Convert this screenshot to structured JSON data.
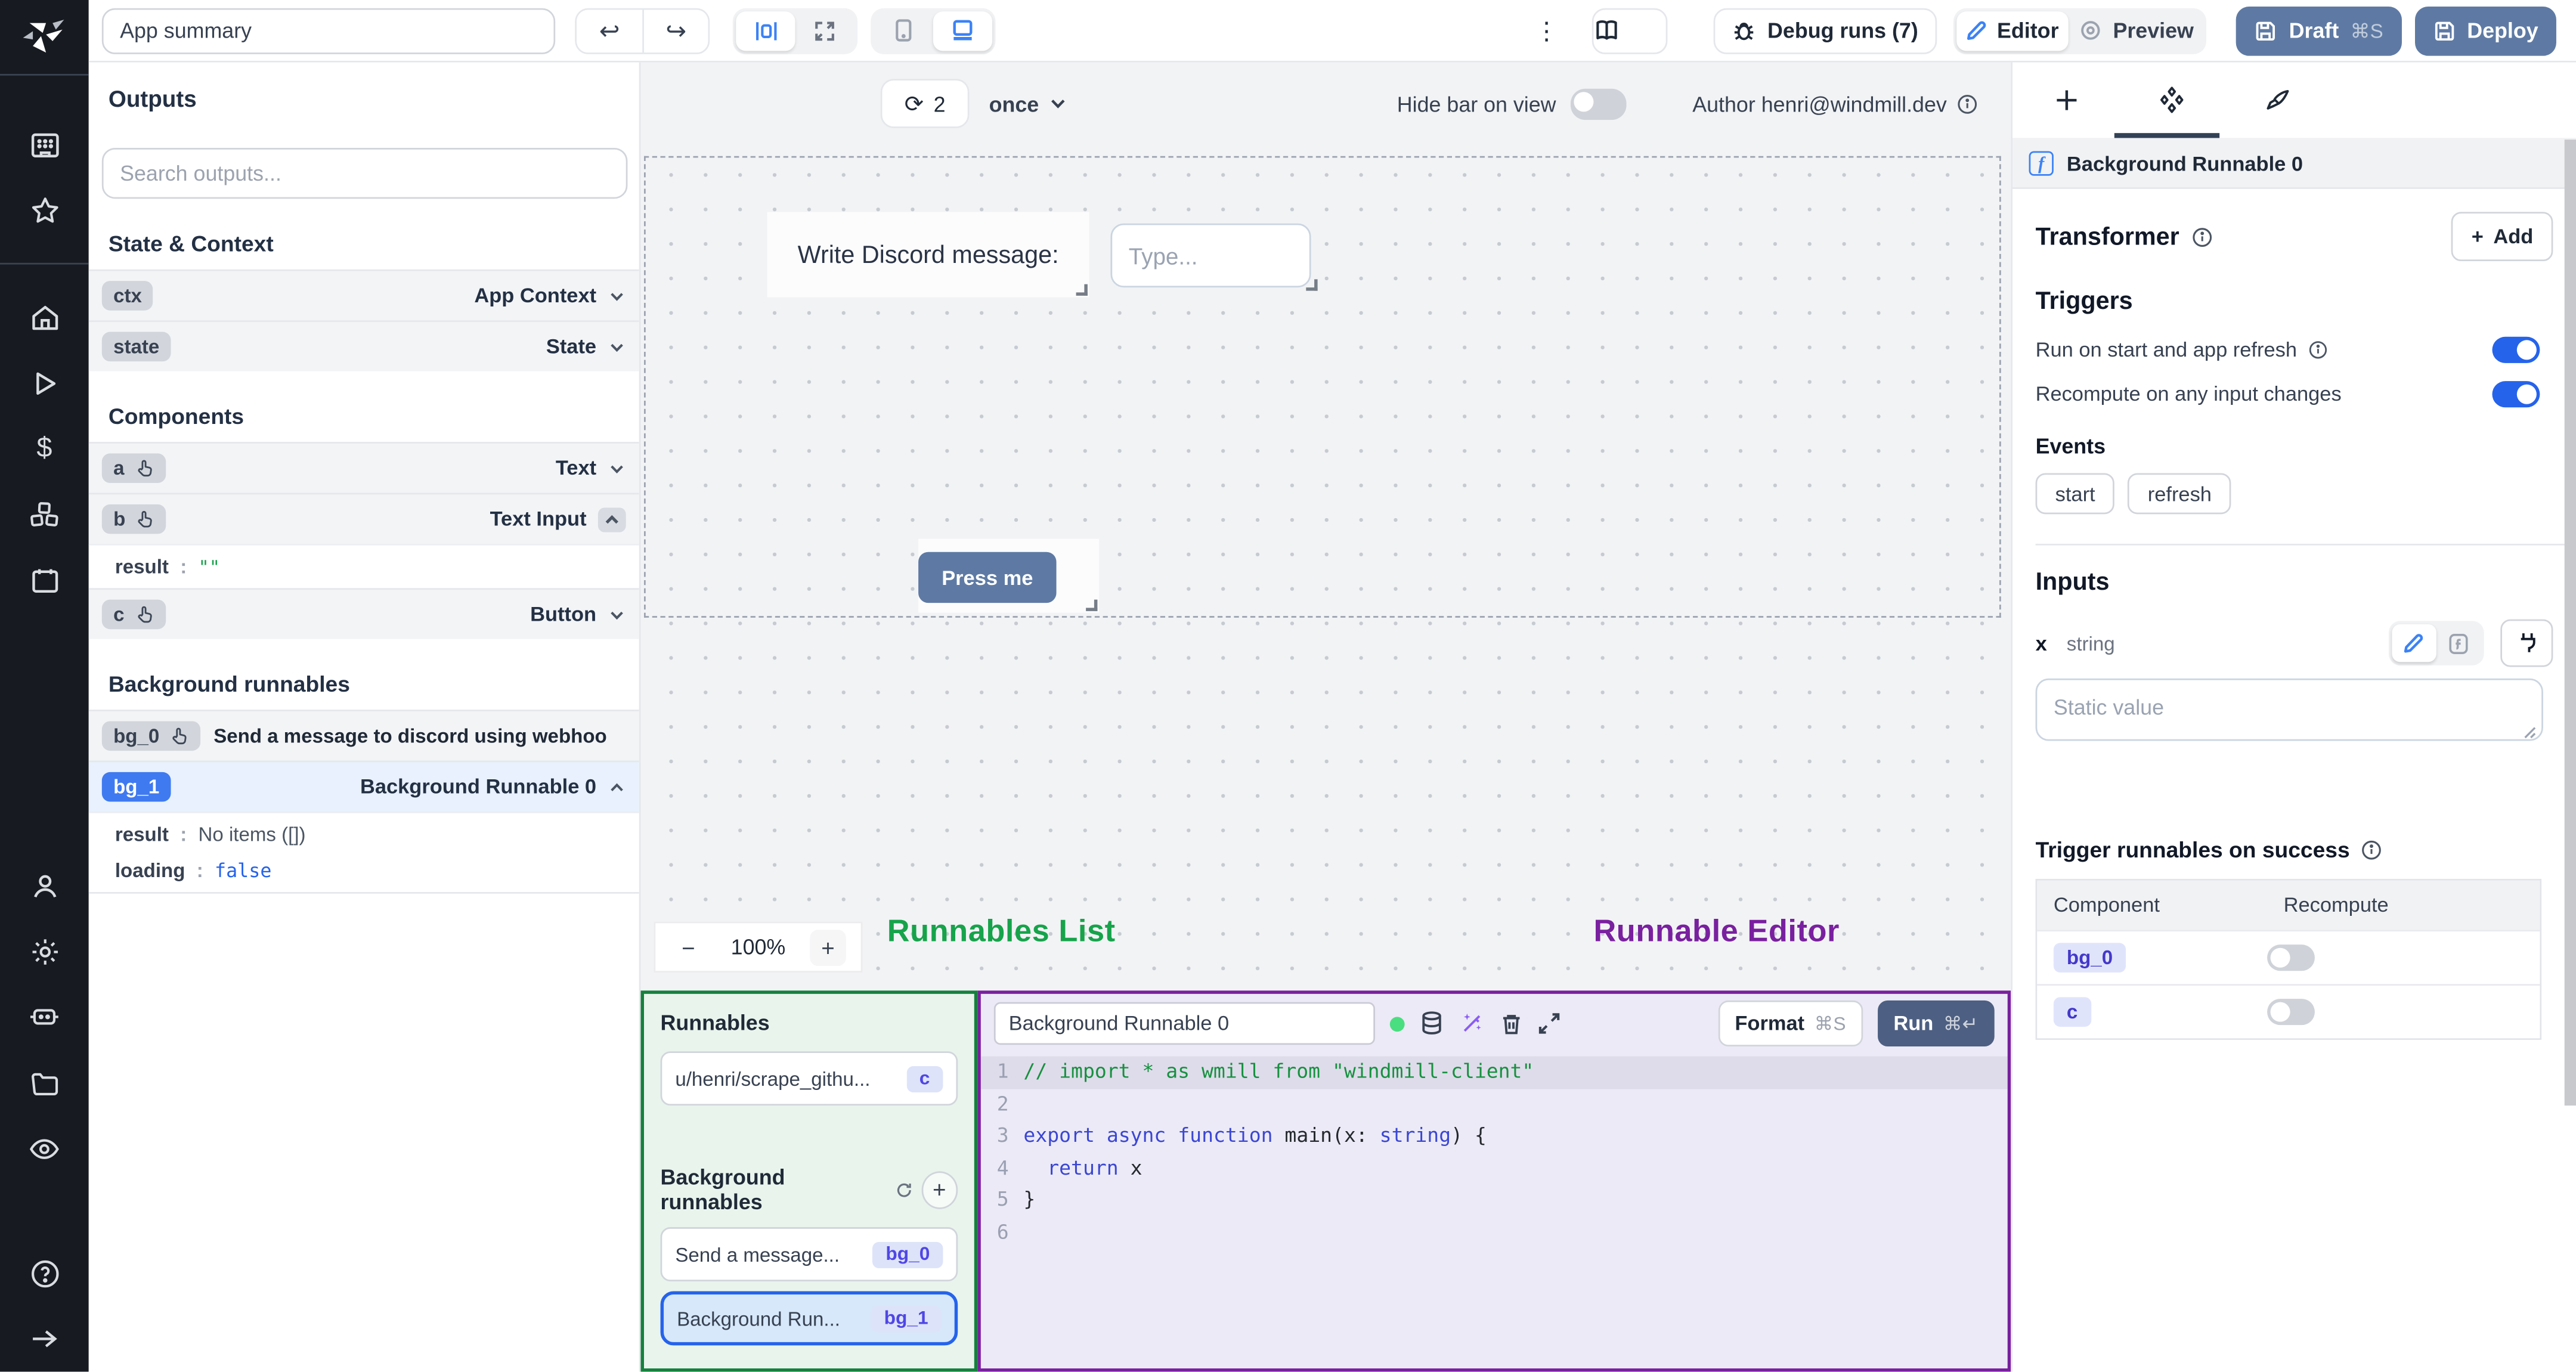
{
  "topbar": {
    "app_summary": "App summary",
    "debug_runs": "Debug runs (7)",
    "editor": "Editor",
    "preview": "Preview",
    "draft": "Draft",
    "draft_kbd": "⌘S",
    "deploy": "Deploy",
    "kebab": "⋮",
    "undo": "↩",
    "redo": "↪"
  },
  "canvas_bar": {
    "refresh_icon": "⟳",
    "refresh_count": "2",
    "frequency": "once",
    "hide_bar_label": "Hide bar on view",
    "author_label": "Author henri@windmill.dev"
  },
  "canvas": {
    "text_label": "Write Discord message:",
    "input_placeholder": "Type...",
    "button_label": "Press me",
    "zoom_level": "100%",
    "zoom_minus": "−",
    "zoom_plus": "+"
  },
  "annotations": {
    "list_label": "Runnables List",
    "editor_label": "Runnable Editor",
    "list_color": "#16a34a",
    "editor_color": "#79209f"
  },
  "outputs": {
    "title": "Outputs",
    "search_placeholder": "Search outputs...",
    "state_context_heading": "State & Context",
    "components_heading": "Components",
    "background_heading": "Background runnables",
    "rows": {
      "ctx": {
        "id": "ctx",
        "type": "App Context"
      },
      "state": {
        "id": "state",
        "type": "State"
      },
      "a": {
        "id": "a",
        "type": "Text"
      },
      "b": {
        "id": "b",
        "type": "Text Input"
      },
      "b_result_key": "result",
      "b_result_val": "\"\"",
      "c": {
        "id": "c",
        "type": "Button"
      },
      "bg0": {
        "id": "bg_0",
        "title": "Send a message to discord using webhoo"
      },
      "bg1": {
        "id": "bg_1",
        "type": "Background Runnable 0"
      },
      "bg1_result_key": "result",
      "bg1_result_val": "No items ([])",
      "bg1_loading_key": "loading",
      "bg1_loading_val": "false",
      "colon": ":"
    }
  },
  "runnables_panel": {
    "title": "Runnables",
    "item1": {
      "label": "u/henri/scrape_githu...",
      "badge": "c"
    },
    "background_heading": "Background runnables",
    "plus": "+",
    "item2": {
      "label": "Send a message...",
      "badge": "bg_0"
    },
    "item3": {
      "label": "Background Run...",
      "badge": "bg_1"
    }
  },
  "editor_panel": {
    "name_value": "Background Runnable 0",
    "format_label": "Format",
    "format_kbd": "⌘S",
    "run_label": "Run",
    "run_kbd": "⌘↵",
    "code_lines": [
      {
        "num": "1",
        "hl": true,
        "tokens": [
          {
            "c": "comment",
            "t": "// import * as wmill from \"windmill-client\""
          }
        ]
      },
      {
        "num": "2",
        "hl": false,
        "tokens": []
      },
      {
        "num": "3",
        "hl": false,
        "tokens": [
          {
            "c": "kw",
            "t": "export"
          },
          {
            "c": "plain",
            "t": " "
          },
          {
            "c": "kw",
            "t": "async"
          },
          {
            "c": "plain",
            "t": " "
          },
          {
            "c": "kw",
            "t": "function"
          },
          {
            "c": "plain",
            "t": " main(x"
          },
          {
            "c": "plain",
            "t": ": "
          },
          {
            "c": "kw",
            "t": "string"
          },
          {
            "c": "plain",
            "t": ") {"
          }
        ]
      },
      {
        "num": "4",
        "hl": false,
        "tokens": [
          {
            "c": "plain",
            "t": "  "
          },
          {
            "c": "kw",
            "t": "return"
          },
          {
            "c": "plain",
            "t": " x"
          }
        ]
      },
      {
        "num": "5",
        "hl": false,
        "tokens": [
          {
            "c": "plain",
            "t": "}"
          }
        ]
      },
      {
        "num": "6",
        "hl": false,
        "tokens": []
      }
    ]
  },
  "right_panel": {
    "selected_runnable": "Background Runnable 0",
    "f_icon": "f",
    "transformer_heading": "Transformer",
    "add_label": "Add",
    "add_plus": "+",
    "triggers_heading": "Triggers",
    "toggle1_label": "Run on start and app refresh",
    "toggle2_label": "Recompute on any input changes",
    "events_heading": "Events",
    "event_chips": {
      "start": "start",
      "refresh": "refresh"
    },
    "inputs_heading": "Inputs",
    "input_name": "x",
    "input_type": "string",
    "static_placeholder": "Static value",
    "trigger_success_heading": "Trigger runnables on success",
    "table": {
      "col1": "Component",
      "col2": "Recompute",
      "row1_badge": "bg_0",
      "row2_badge": "c"
    }
  }
}
